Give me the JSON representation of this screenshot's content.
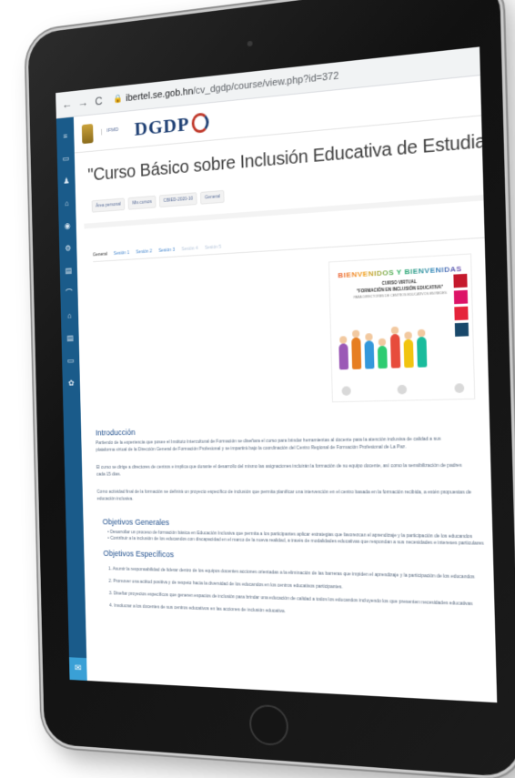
{
  "browser": {
    "back": "←",
    "forward": "→",
    "reload": "C",
    "lock": "🔒",
    "url_host": "ibertel.se.gob.hn",
    "url_path": "/cv_dgdp/course/view.php?id=372"
  },
  "sidebar": {
    "items": [
      "≡",
      "▭",
      "♟",
      "⌂",
      "◉",
      "⚙",
      "▤",
      "⌒",
      "⌂",
      "▤",
      "▭",
      "✿"
    ],
    "bottom_icon": "✉"
  },
  "header": {
    "logo_text": "DGDP",
    "small_logo_text": "IFMD"
  },
  "course": {
    "title": "\"Curso Básico sobre Inclusión Educativa de Estudiantes con Discapacidad\"",
    "breadcrumb": [
      "Área personal",
      "Mis cursos",
      "CBIED-2020-10",
      "General"
    ]
  },
  "tabs": [
    {
      "label": "General"
    },
    {
      "label": "Sesión 1"
    },
    {
      "label": "Sesión 2"
    },
    {
      "label": "Sesión 3"
    },
    {
      "label": "Sesión 4"
    },
    {
      "label": "Sesión 5"
    }
  ],
  "welcome": {
    "heading": "BIENVENIDOS Y BIENVENIDAS",
    "line1": "CURSO VIRTUAL",
    "line2": "\"FORMACIÓN EN INCLUSIÓN EDUCATIVA\"",
    "line3": "PARA DIRECTORES DE CENTROS EDUCATIVOS EN REDES",
    "sdg_colors": [
      "#c5192d",
      "#dd1367",
      "#e5243b",
      "#19486a"
    ]
  },
  "content": {
    "intro_title": "Introducción",
    "intro_p1_l1": "Partiendo de la experiencia que posee el Instituto Intercultural de Formación se diseñara el curso para brindar herramientas al docente para la atención inclusiva de calidad a sus",
    "intro_p1_l2": "plataforma virtual de la Dirección General de Formación Profesional y se impartirá bajo la coordinación del Centro Regional de Formación Profesional de La Paz.",
    "intro_p2_l1": "El curso se dirige a directores de centros e implica que durante el desarrollo del mismo las asignaciones incluirán la formación de su equipo docente, así como la sensibilización de padres",
    "intro_p2_l2": "cada 15 días.",
    "intro_p3_l1": "Como actividad final de la formación se definirá un proyecto específico de inclusión que permita planificar una intervención en el centro basada en la formación recibida, a estén propuestas de",
    "intro_p3_l2": "educación inclusiva.",
    "general_title": "Objetivos Generales",
    "general_items": [
      "• Desarrollar un proceso de formación básica en Educación Inclusiva que permita a los participantes aplicar estrategias que favorezcan el aprendizaje y la participación de los educandos",
      "• Contribuir a la inclusión de los educandos con discapacidad en el marco de la nueva realidad, a través de modalidades educativas que respondan a sus necesidades e intereses particulares"
    ],
    "specific_title": "Objetivos Específicos",
    "specific_items": [
      "1. Asumir la responsabilidad de liderar dentro de los equipos docentes acciones orientadas a la eliminación de las barreras que impiden el aprendizaje y la participación de los educandos",
      "2. Promover una actitud positiva y de respeto hacia la diversidad de los educandos en los centros educativos participantes.",
      "3. Diseñar proyectos específicos que generen espacios de inclusión para brindar una educación de calidad a todos los educandos incluyendo los que presenten necesidades educativas",
      "4. Involucrar a los docentes de sus centros educativos en las acciones de inclusión educativa."
    ]
  }
}
